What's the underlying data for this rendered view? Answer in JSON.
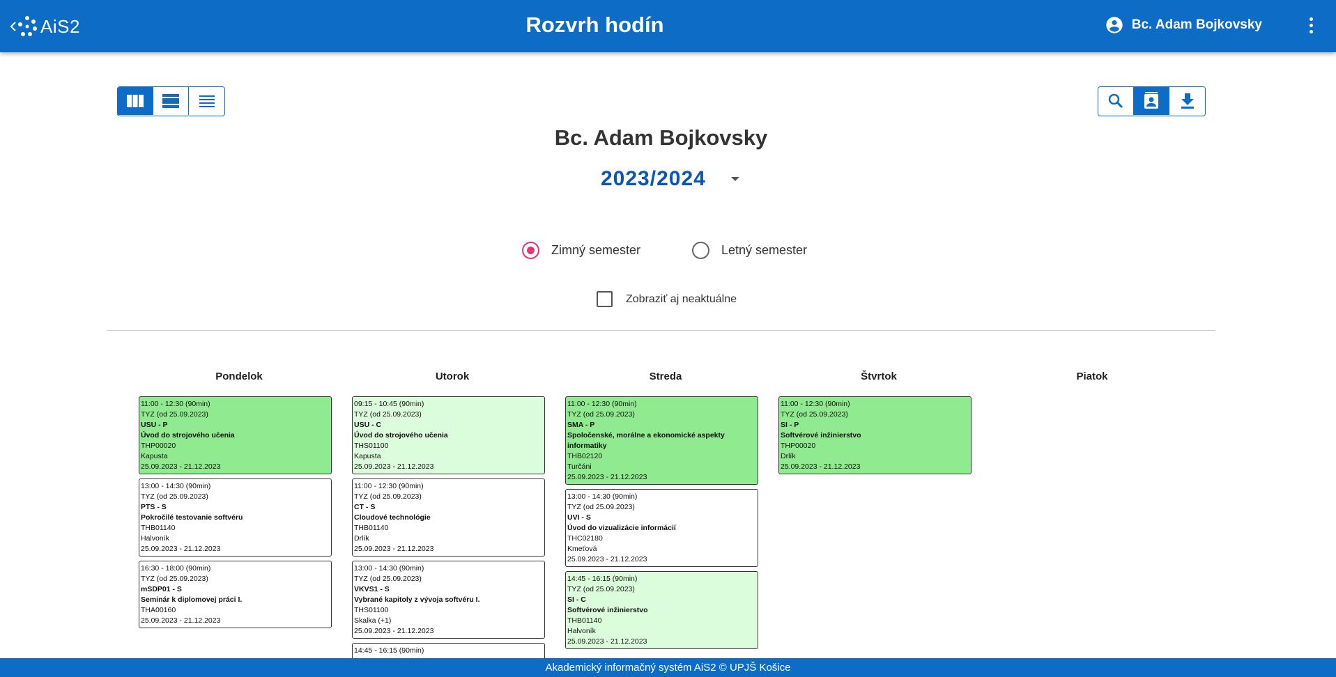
{
  "header": {
    "logo_text": "AiS2",
    "title": "Rozvrh hodín",
    "user_name": "Bc. Adam Bojkovsky"
  },
  "view_buttons": [
    "view-columns-icon",
    "view-agenda-icon",
    "view-list-icon"
  ],
  "action_buttons": [
    "search-icon",
    "contact-card-icon",
    "download-icon"
  ],
  "person_name": "Bc. Adam Bojkovsky",
  "academic_year": "2023/2024",
  "semesters": [
    {
      "label": "Zimný semester",
      "selected": true
    },
    {
      "label": "Letný semester",
      "selected": false
    }
  ],
  "show_outdated_label": "Zobraziť aj neaktuálne",
  "days": [
    "Pondelok",
    "Utorok",
    "Streda",
    "Štvrtok",
    "Piatok"
  ],
  "colors": {
    "primary": "#0d6cc6",
    "lecture": "#90ea8f",
    "exercise": "#dcfddc",
    "radio_accent": "#e8346f"
  },
  "schedule": {
    "pondelok": [
      {
        "time": "11:00 - 12:30 (90min)",
        "week": "TYZ (od 25.09.2023)",
        "code": "USU - P",
        "name": "Úvod do strojového učenia",
        "room": "THP00020",
        "teacher": "Kapusta",
        "dates": "25.09.2023 - 21.12.2023"
      },
      {
        "time": "13:00 - 14:30 (90min)",
        "week": "TYZ (od 25.09.2023)",
        "code": "PTS - S",
        "name": "Pokročilé testovanie softvéru",
        "room": "THB01140",
        "teacher": "Halvoník",
        "dates": "25.09.2023 - 21.12.2023"
      },
      {
        "time": "16:30 - 18:00 (90min)",
        "week": "TYZ (od 25.09.2023)",
        "code": "mSDP01 - S",
        "name": "Seminár k diplomovej práci I.",
        "room": "THA00160",
        "dates": "25.09.2023 - 21.12.2023"
      }
    ],
    "utorok": [
      {
        "time": "09:15 - 10:45 (90min)",
        "week": "TYZ (od 25.09.2023)",
        "code": "USU - C",
        "name": "Úvod do strojového učenia",
        "room": "THS01100",
        "teacher": "Kapusta",
        "dates": "25.09.2023 - 21.12.2023"
      },
      {
        "time": "11:00 - 12:30 (90min)",
        "week": "TYZ (od 25.09.2023)",
        "code": "CT - S",
        "name": "Cloudové technológie",
        "room": "THB01140",
        "teacher": "Drlík",
        "dates": "25.09.2023 - 21.12.2023"
      },
      {
        "time": "13:00 - 14:30 (90min)",
        "week": "TYZ (od 25.09.2023)",
        "code": "VKVS1 - S",
        "name": "Vybrané kapitoly z vývoja softvéru I.",
        "room": "THS01100",
        "teacher": "Skalka (+1)",
        "dates": "25.09.2023 - 21.12.2023"
      },
      {
        "time": "14:45 - 16:15 (90min)"
      }
    ],
    "streda": [
      {
        "time": "11:00 - 12:30 (90min)",
        "week": "TYZ (od 25.09.2023)",
        "code": "SMA - P",
        "name": "Spoločenské, morálne a ekonomické aspekty informatiky",
        "room": "THB02120",
        "teacher": "Turčáni",
        "dates": "25.09.2023 - 21.12.2023"
      },
      {
        "time": "13:00 - 14:30 (90min)",
        "week": "TYZ (od 25.09.2023)",
        "code": "UVI - S",
        "name": "Úvod do vizualizácie informácií",
        "room": "THC02180",
        "teacher": "Kmeťová",
        "dates": "25.09.2023 - 21.12.2023"
      },
      {
        "time": "14:45 - 16:15 (90min)",
        "week": "TYZ (od 25.09.2023)",
        "code": "SI - C",
        "name": "Softvérové inžinierstvo",
        "room": "THB01140",
        "teacher": "Halvoník",
        "dates": "25.09.2023 - 21.12.2023"
      }
    ],
    "stvrtok": [
      {
        "time": "11:00 - 12:30 (90min)",
        "week": "TYZ (od 25.09.2023)",
        "code": "SI - P",
        "name": "Softvérové inžinierstvo",
        "room": "THP00020",
        "teacher": "Drlík",
        "dates": "25.09.2023 - 21.12.2023"
      }
    ]
  },
  "footer": "Akademický informačný systém AiS2 © UPJŠ Košice"
}
